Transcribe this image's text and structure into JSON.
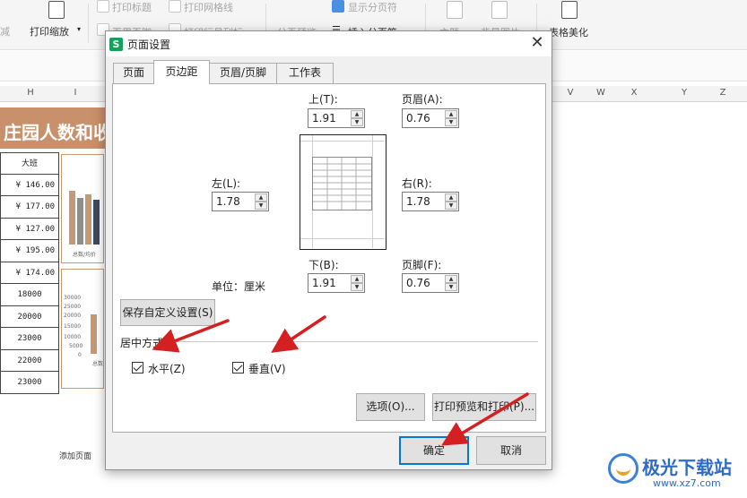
{
  "background": {
    "ribbon": {
      "items": [
        {
          "label": "减",
          "dim": true
        },
        {
          "label": "打印缩放"
        },
        {
          "label": "打印标题",
          "dim": true
        },
        {
          "label": "打印网格线",
          "dim": true
        },
        {
          "label": "显示分页符",
          "dim": true
        },
        {
          "label": "页眉页脚",
          "dim": true
        },
        {
          "label": "打印行号列标",
          "dim": true
        },
        {
          "label": "分页预览",
          "dim": true
        },
        {
          "label": "插入分页符"
        },
        {
          "label": "主题",
          "dim": true
        },
        {
          "label": "背景图片",
          "dim": true
        },
        {
          "label": "表格美化"
        }
      ]
    },
    "columns": [
      "H",
      "I",
      "V",
      "W",
      "X",
      "Y",
      "Z"
    ],
    "sheet_title": "庄园人数和收",
    "table_header": "大班",
    "table_values": [
      "¥ 146.00",
      "¥ 177.00",
      "¥ 127.00",
      "¥ 195.00",
      "¥ 174.00",
      "18000",
      "20000",
      "23000",
      "22000",
      "23000"
    ],
    "chart_axis": [
      "30000",
      "25000",
      "20000",
      "15000",
      "10000",
      "5000",
      "0"
    ],
    "chart_label_1": "总数/均价",
    "chart_label_2": "总数",
    "add_page": "添加页面"
  },
  "dialog": {
    "title": "页面设置",
    "logo": "S",
    "tabs": [
      {
        "label": "页面",
        "active": false
      },
      {
        "label": "页边距",
        "active": true
      },
      {
        "label": "页眉/页脚",
        "active": false
      },
      {
        "label": "工作表",
        "active": false
      }
    ],
    "margins": {
      "top": {
        "label": "上(T):",
        "value": "1.91"
      },
      "header": {
        "label": "页眉(A):",
        "value": "0.76"
      },
      "left": {
        "label": "左(L):",
        "value": "1.78"
      },
      "right": {
        "label": "右(R):",
        "value": "1.78"
      },
      "bottom": {
        "label": "下(B):",
        "value": "1.91"
      },
      "footer": {
        "label": "页脚(F):",
        "value": "0.76"
      }
    },
    "unit_label": "单位：厘米",
    "save_custom": "保存自定义设置(S)",
    "center_section": "居中方式",
    "horizontal": {
      "label": "水平(Z)",
      "checked": true
    },
    "vertical": {
      "label": "垂直(V)",
      "checked": true
    },
    "options_button": "选项(O)...",
    "print_preview_button": "打印预览和打印(P)...",
    "ok_button": "确定",
    "cancel_button": "取消"
  },
  "annotation_color": "#d42020",
  "watermark": {
    "text": "极光下载站",
    "url": "www.xz7.com"
  }
}
